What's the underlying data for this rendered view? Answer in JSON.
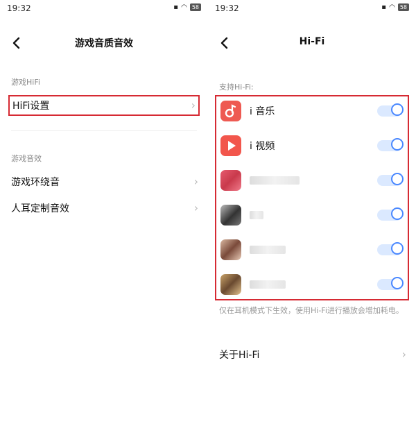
{
  "left": {
    "status": {
      "time": "19:32",
      "battery": "58"
    },
    "title": "游戏音质音效",
    "sections": [
      {
        "label": "游戏HiFi",
        "items": [
          {
            "label": "HiFi设置"
          }
        ]
      },
      {
        "label": "游戏音效",
        "items": [
          {
            "label": "游戏环绕音"
          },
          {
            "label": "人耳定制音效"
          }
        ]
      }
    ]
  },
  "right": {
    "status": {
      "time": "19:32",
      "battery": "58"
    },
    "title": "Hi-Fi",
    "supported_label": "支持Hi-Fi:",
    "apps": [
      {
        "name": "i 音乐",
        "icon": "music-app-icon",
        "enabled": true
      },
      {
        "name": "i 视频",
        "icon": "video-app-icon",
        "enabled": true
      },
      {
        "name": "",
        "icon": "blurred-app-icon",
        "enabled": true
      },
      {
        "name": "",
        "icon": "blurred-app-icon",
        "enabled": true
      },
      {
        "name": "",
        "icon": "blurred-app-icon",
        "enabled": true
      },
      {
        "name": "",
        "icon": "blurred-app-icon",
        "enabled": true
      }
    ],
    "note": "仅在耳机模式下生效，使用Hi-Fi进行播放会增加耗电。",
    "about": "关于Hi-Fi"
  },
  "colors": {
    "highlight": "#d62a33",
    "toggle": "#4a88ff"
  }
}
